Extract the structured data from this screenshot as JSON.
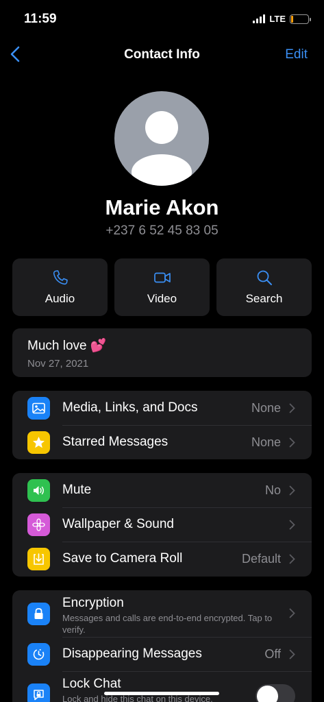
{
  "status_bar": {
    "time": "11:59",
    "network": "LTE",
    "battery_color": "#ff9f0a"
  },
  "nav": {
    "title": "Contact Info",
    "edit_label": "Edit",
    "back_icon": "chevron-left-icon"
  },
  "contact": {
    "name": "Marie Akon",
    "phone": "+237 6 52 45 83 05"
  },
  "actions": [
    {
      "label": "Audio",
      "icon": "phone-icon"
    },
    {
      "label": "Video",
      "icon": "video-camera-icon"
    },
    {
      "label": "Search",
      "icon": "search-icon"
    }
  ],
  "about": {
    "text": "Much love 💕",
    "date": "Nov 27, 2021"
  },
  "media_section": [
    {
      "label": "Media, Links, and Docs",
      "value": "None",
      "icon": "photo-icon",
      "color": "#1a82f7"
    },
    {
      "label": "Starred Messages",
      "value": "None",
      "icon": "star-icon",
      "color": "#f7c600"
    }
  ],
  "settings_section": [
    {
      "label": "Mute",
      "value": "No",
      "icon": "speaker-icon",
      "color": "#2fc150"
    },
    {
      "label": "Wallpaper & Sound",
      "value": "",
      "icon": "flower-icon",
      "color": "#d55ad8"
    },
    {
      "label": "Save to Camera Roll",
      "value": "Default",
      "icon": "download-icon",
      "color": "#f7c600"
    }
  ],
  "privacy_section": {
    "encryption": {
      "label": "Encryption",
      "sub": "Messages and calls are end-to-end encrypted. Tap to verify.",
      "icon": "lock-icon",
      "color": "#1a82f7"
    },
    "disappearing": {
      "label": "Disappearing Messages",
      "value": "Off",
      "icon": "timer-icon",
      "color": "#1a82f7"
    },
    "lock_chat": {
      "label": "Lock Chat",
      "sub": "Lock and hide this chat on this device.",
      "icon": "chat-lock-icon",
      "color": "#1a82f7",
      "enabled": false
    }
  },
  "colors": {
    "accent": "#3a8ff5",
    "card": "#1c1c1e",
    "secondary_text": "#8e8e93"
  }
}
